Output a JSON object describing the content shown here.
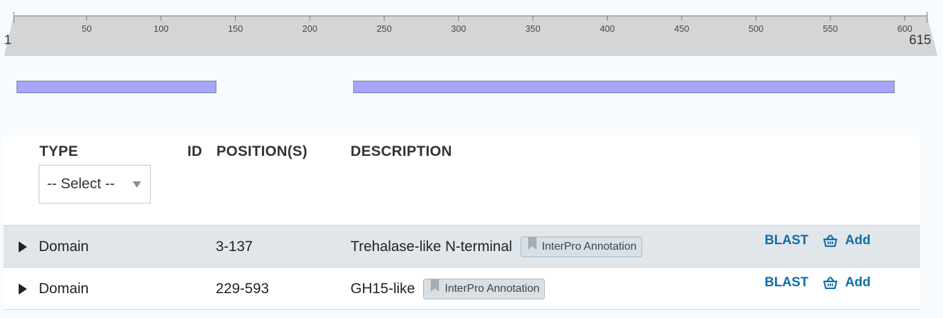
{
  "sequence_viewer": {
    "start": 1,
    "end": 615,
    "start_label": "1",
    "end_label": "615",
    "ticks": [
      50,
      100,
      150,
      200,
      250,
      300,
      350,
      400,
      450,
      500,
      550,
      600
    ],
    "feature_color": "#a7a6ff",
    "features": [
      {
        "start": 3,
        "end": 137
      },
      {
        "start": 229,
        "end": 593
      }
    ]
  },
  "table": {
    "headers": {
      "type": "TYPE",
      "id": "ID",
      "positions": "POSITION(S)",
      "description": "DESCRIPTION"
    },
    "type_filter": {
      "selected": "-- Select --"
    },
    "rows": [
      {
        "type": "Domain",
        "id": "",
        "positions": "3-137",
        "description": "Trehalase-like N-terminal",
        "badge": "InterPro Annotation",
        "blast": "BLAST",
        "add": "Add"
      },
      {
        "type": "Domain",
        "id": "",
        "positions": "229-593",
        "description": "GH15-like",
        "badge": "InterPro Annotation",
        "blast": "BLAST",
        "add": "Add"
      }
    ]
  },
  "colors": {
    "link": "#0f6ea6",
    "row_shaded": "#e1e6ea"
  }
}
